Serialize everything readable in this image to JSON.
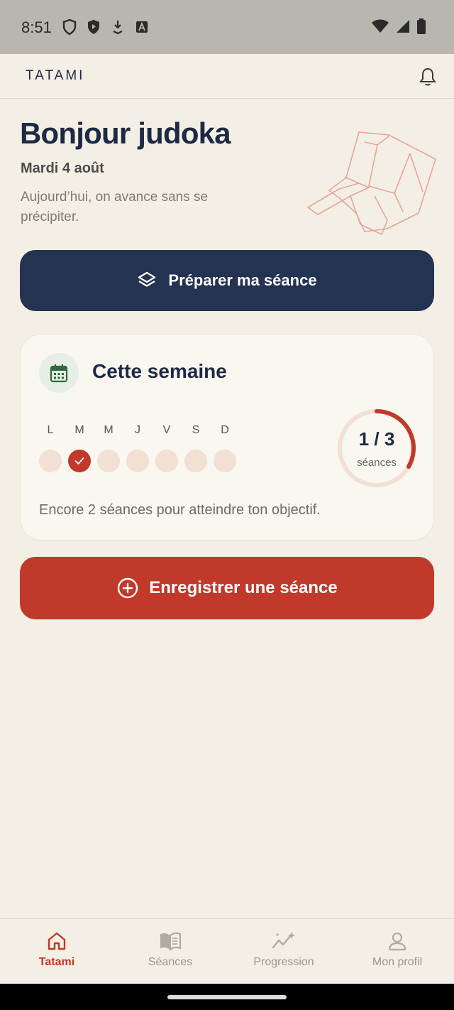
{
  "status": {
    "time": "8:51"
  },
  "app": {
    "title": "TATAMI"
  },
  "hero": {
    "greeting": "Bonjour judoka",
    "date": "Mardi 4 août",
    "tagline": "Aujourd’hui, on avance sans se précipiter."
  },
  "prepare_button": {
    "label": "Préparer ma séance"
  },
  "week_card": {
    "title": "Cette semaine",
    "days": [
      {
        "letter": "L",
        "done": false
      },
      {
        "letter": "M",
        "done": true
      },
      {
        "letter": "M",
        "done": false
      },
      {
        "letter": "J",
        "done": false
      },
      {
        "letter": "V",
        "done": false
      },
      {
        "letter": "S",
        "done": false
      },
      {
        "letter": "D",
        "done": false
      }
    ],
    "progress": {
      "value": "1 / 3",
      "label": "séances",
      "fraction": 0.333
    },
    "footer": "Encore 2 séances pour atteindre ton objectif."
  },
  "record_button": {
    "label": "Enregistrer une séance"
  },
  "nav": [
    {
      "label": "Tatami",
      "icon": "home-icon",
      "active": true
    },
    {
      "label": "Séances",
      "icon": "book-icon",
      "active": false
    },
    {
      "label": "Progression",
      "icon": "sparkle-chart-icon",
      "active": false
    },
    {
      "label": "Mon profil",
      "icon": "user-icon",
      "active": false
    }
  ],
  "colors": {
    "navy": "#243351",
    "red": "#c0392b",
    "background": "#f3efe5"
  }
}
